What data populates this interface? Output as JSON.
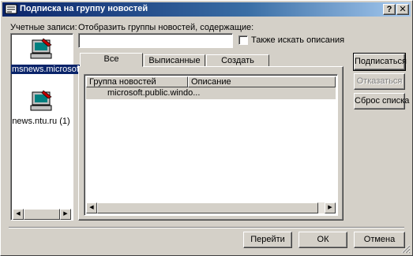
{
  "window": {
    "title": "Подписка на группу новостей",
    "help_button": "?",
    "close_button": "✕"
  },
  "accounts": {
    "label": "Учетные записи:",
    "items": [
      {
        "label": "msnews.microsoft....",
        "selected": true
      },
      {
        "label": "news.ntu.ru (1)",
        "selected": false
      }
    ]
  },
  "filter": {
    "label": "Отобразить группы новостей, содержащие:",
    "value": "",
    "checkbox_label": "Также искать описания",
    "checked": false
  },
  "tabs": [
    {
      "label": "Все",
      "active": true
    },
    {
      "label": "Выписанные",
      "active": false
    },
    {
      "label": "Создать",
      "active": false
    }
  ],
  "groups_table": {
    "columns": [
      "Группа новостей",
      "Описание"
    ],
    "rows": [
      {
        "group": "microsoft.public.windo...",
        "description": ""
      }
    ]
  },
  "side_buttons": {
    "subscribe": "Подписаться",
    "unsubscribe": "Отказаться",
    "reset": "Сброс списка"
  },
  "footer_buttons": {
    "goto": "Перейти",
    "ok": "ОК",
    "cancel": "Отмена"
  },
  "colors": {
    "face": "#d4d0c8",
    "title_start": "#0a246a",
    "title_end": "#a6caf0",
    "selection": "#0a246a",
    "disabled_text": "#808080"
  }
}
